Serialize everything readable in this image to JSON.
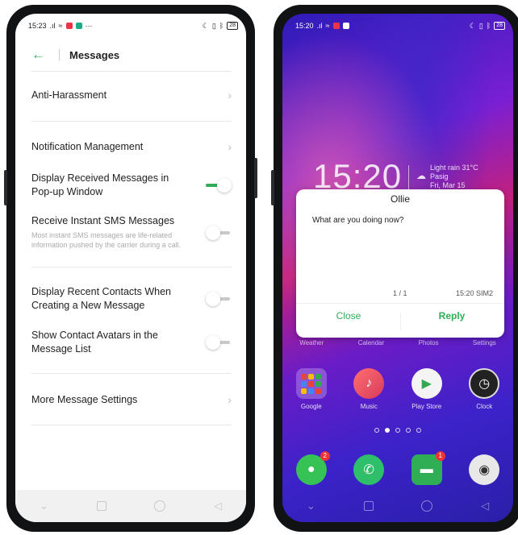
{
  "left_screen": {
    "status": {
      "time": "15:23",
      "signal": "ᵢₗ .ıl",
      "wifi": "≈",
      "extra": "⋯",
      "battery": "28"
    },
    "header": {
      "back_glyph": "←",
      "title": "Messages"
    },
    "rows": [
      {
        "label": "Anti-Harassment",
        "type": "link"
      },
      {
        "label": "Notification Management",
        "type": "link"
      },
      {
        "label": "Display Received Messages in Pop-up Window",
        "type": "toggle",
        "state": "on"
      },
      {
        "label": "Receive Instant SMS Messages",
        "description": "Most instant SMS messages are life-related information pushed by the carrier during a call.",
        "type": "toggle",
        "state": "off"
      },
      {
        "label": "Display Recent Contacts When Creating a New Message",
        "type": "toggle",
        "state": "off"
      },
      {
        "label": "Show Contact Avatars in the Message List",
        "type": "toggle",
        "state": "off"
      },
      {
        "label": "More Message Settings",
        "type": "link"
      }
    ],
    "chevron_glyph": "›",
    "nav": {
      "back": "◁",
      "recents": "",
      "home": "",
      "down": "⌄"
    }
  },
  "right_screen": {
    "status": {
      "time": "15:20",
      "signal": "ᵢₗ .ıl",
      "wifi": "≈",
      "battery": "28"
    },
    "clock": "15:20",
    "weather": {
      "line1": "Light rain 31°C",
      "line2": "Pasig",
      "line3": "Fri, Mar 15",
      "icon": "cloud-rain-icon"
    },
    "popup": {
      "sender": "Ollie",
      "message": "What are you doing now?",
      "count": "1 / 1",
      "time": "15:20 SIM2",
      "close_label": "Close",
      "reply_label": "Reply"
    },
    "top_row_labels": [
      "Weather",
      "Calendar",
      "Photos",
      "Settings"
    ],
    "apps": [
      {
        "name": "Google",
        "icon": "google-folder-icon"
      },
      {
        "name": "Music",
        "icon": "music-icon"
      },
      {
        "name": "Play Store",
        "icon": "play-store-icon"
      },
      {
        "name": "Clock",
        "icon": "clock-icon"
      }
    ],
    "dock": [
      {
        "icon": "wechat-icon",
        "badge": "2"
      },
      {
        "icon": "phone-icon",
        "badge": ""
      },
      {
        "icon": "messages-icon",
        "badge": "1"
      },
      {
        "icon": "camera-icon",
        "badge": ""
      }
    ],
    "page_dots": 5,
    "active_dot": 1
  },
  "colors": {
    "accent": "#2fae55",
    "badge": "#ee3333"
  }
}
